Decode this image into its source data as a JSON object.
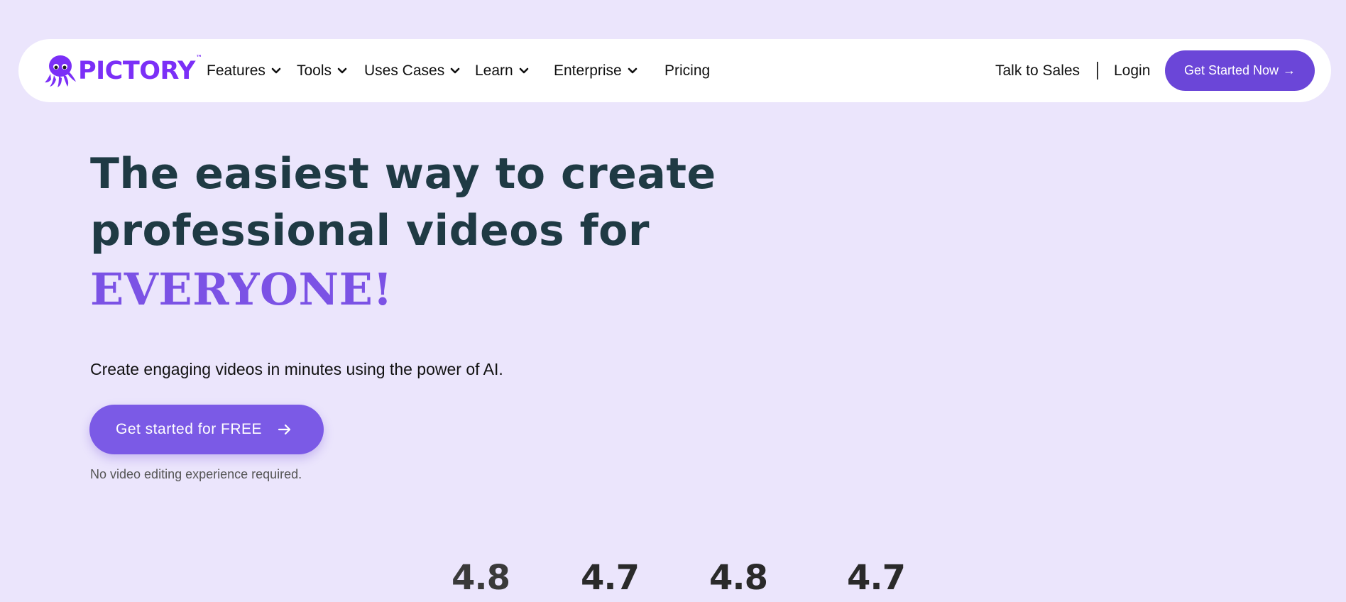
{
  "brand": {
    "name": "PICTORY",
    "trademark": "™",
    "color": "#7b2ff7"
  },
  "nav": {
    "items": [
      {
        "label": "Features",
        "has_dropdown": true
      },
      {
        "label": "Tools",
        "has_dropdown": true
      },
      {
        "label": "Uses Cases",
        "has_dropdown": true
      },
      {
        "label": "Learn",
        "has_dropdown": true
      },
      {
        "label": "Enterprise",
        "has_dropdown": true
      },
      {
        "label": "Pricing",
        "has_dropdown": false
      }
    ],
    "talk_to_sales": "Talk to Sales",
    "login": "Login",
    "cta_label": "Get Started Now",
    "cta_arrow": "→"
  },
  "hero": {
    "title_line1": "The easiest way to create",
    "title_line2": "professional videos for",
    "title_accent": "EVERYONE!",
    "subtitle": "Create engaging videos in minutes using the power of AI.",
    "cta_label": "Get started for FREE",
    "note": "No video editing experience required."
  },
  "ratings": [
    "4.8",
    "4.7",
    "4.8",
    "4.7"
  ],
  "colors": {
    "background": "#ebe5fc",
    "accent": "#7b52e5",
    "button": "#6b46d8",
    "heading": "#1f3a44"
  },
  "icons": {
    "logo": "octopus-icon",
    "dropdown": "chevron-down-icon",
    "arrow": "arrow-right-icon"
  }
}
